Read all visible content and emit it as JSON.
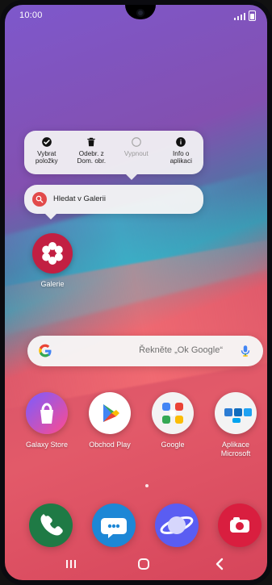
{
  "status": {
    "time": "10:00"
  },
  "context_menu": {
    "items": [
      {
        "name": "select-items",
        "label": "Vybrat\npoložky",
        "icon": "check-circle-icon",
        "disabled": false
      },
      {
        "name": "remove-from-home",
        "label": "Odebr. z\nDom. obr.",
        "icon": "trash-icon",
        "disabled": false
      },
      {
        "name": "disable",
        "label": "Vypnout",
        "icon": "empty-circle-icon",
        "disabled": true
      },
      {
        "name": "app-info",
        "label": "Info o\naplikaci",
        "icon": "info-icon",
        "disabled": false
      }
    ]
  },
  "shortcut": {
    "label": "Hledat v Galerii",
    "icon": "search-icon"
  },
  "gallery": {
    "label": "Galerie",
    "icon": "flower-icon"
  },
  "google_bar": {
    "hint": "Řekněte „Ok Google“",
    "icon_left": "google-g-icon",
    "icon_right": "mic-icon"
  },
  "apps_row": [
    {
      "name": "galaxy-store",
      "label": "Galaxy Store",
      "icon": "shopping-bag-icon"
    },
    {
      "name": "obchod-play",
      "label": "Obchod Play",
      "icon": "play-store-icon"
    },
    {
      "name": "google",
      "label": "Google",
      "icon": "google-folder-icon"
    },
    {
      "name": "aplikace-microsoft",
      "label": "Aplikace\nMicrosoft",
      "icon": "microsoft-folder-icon"
    }
  ],
  "dock": [
    {
      "name": "phone",
      "icon": "phone-icon"
    },
    {
      "name": "messages",
      "icon": "chat-icon"
    },
    {
      "name": "internet",
      "icon": "planet-icon"
    },
    {
      "name": "camera",
      "icon": "camera-icon"
    }
  ],
  "nav": {
    "recents": "recents-icon",
    "home": "home-icon",
    "back": "back-icon"
  }
}
